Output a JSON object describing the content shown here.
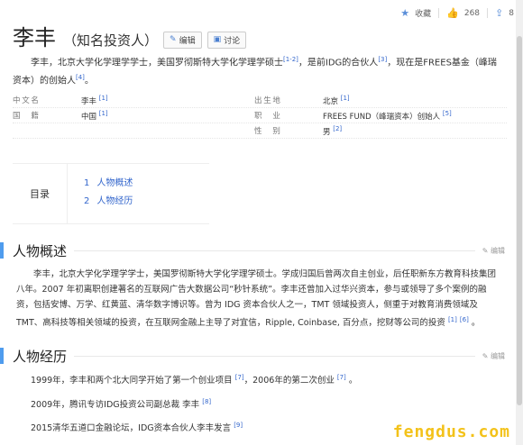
{
  "topbar": {
    "favorite_label": "收藏",
    "like_count": "268",
    "share_count": "8"
  },
  "header": {
    "title": "李丰",
    "subtitle": "（知名投资人）",
    "edit_label": "编辑",
    "discuss_label": "讨论"
  },
  "summary": {
    "text1": "李丰，北京大学化学理学学士，美国罗彻斯特大学化学理学硕士",
    "ref1": "[1-2]",
    "text2": "，是前IDG的合伙人",
    "ref2": "[3]",
    "text3": "，现在是FREES基金（峰瑞资本）的创始人",
    "ref3": "[4]",
    "text4": "。"
  },
  "basic_info": [
    {
      "k1": "中文名",
      "v1": "李丰",
      "r1": "[1]",
      "k2": "出生地",
      "v2": "北京",
      "r2": "[1]"
    },
    {
      "k1": "国　籍",
      "v1": "中国",
      "r1": "[1]",
      "k2": "职　业",
      "v2": "FREES FUND（峰瑞资本）创始人",
      "r2": "[5]"
    },
    {
      "k1": "",
      "v1": "",
      "r1": "",
      "k2": "性　别",
      "v2": "男",
      "r2": "[2]"
    }
  ],
  "toc": {
    "label": "目录",
    "items": [
      {
        "num": "1",
        "label": "人物概述"
      },
      {
        "num": "2",
        "label": "人物经历"
      }
    ]
  },
  "section1": {
    "heading": "人物概述",
    "edit": "编辑",
    "text": "李丰，北京大学化学理学学士，美国罗彻斯特大学化学理学硕士。学成归国后曾两次自主创业，后任职新东方教育科技集团八年。2007 年初离职创建著名的互联网广告大数据公司“秒针系统”。李丰还曾加入过华兴资本，参与或领导了多个案例的融资，包括安博、万学、红黄蓝、清华数字博识等。曾为 IDG 资本合伙人之一，TMT 领域投资人，侧重于对教育消费领域及 TMT、高科技等相关领域的投资，在互联网金融上主导了对宜信，Ripple, Coinbase, 百分点，挖财等公司的投资",
    "ref1": "[1]",
    "ref2": "[6]",
    "tail": "。"
  },
  "section2": {
    "heading": "人物经历",
    "edit": "编辑",
    "items": [
      {
        "text": "1999年，李丰和两个北大同学开始了第一个创业项目",
        "ref": "[7]",
        "text2": "，2006年的第二次创业",
        "ref2": "[7]",
        "tail": "。"
      },
      {
        "text": "2009年，腾讯专访IDG投资公司副总裁 李丰",
        "ref": "[8]"
      },
      {
        "text": "2015清华五道口金融论坛，IDG资本合伙人李丰发言",
        "ref": "[9]"
      }
    ]
  },
  "watermark": "fengdus.com"
}
